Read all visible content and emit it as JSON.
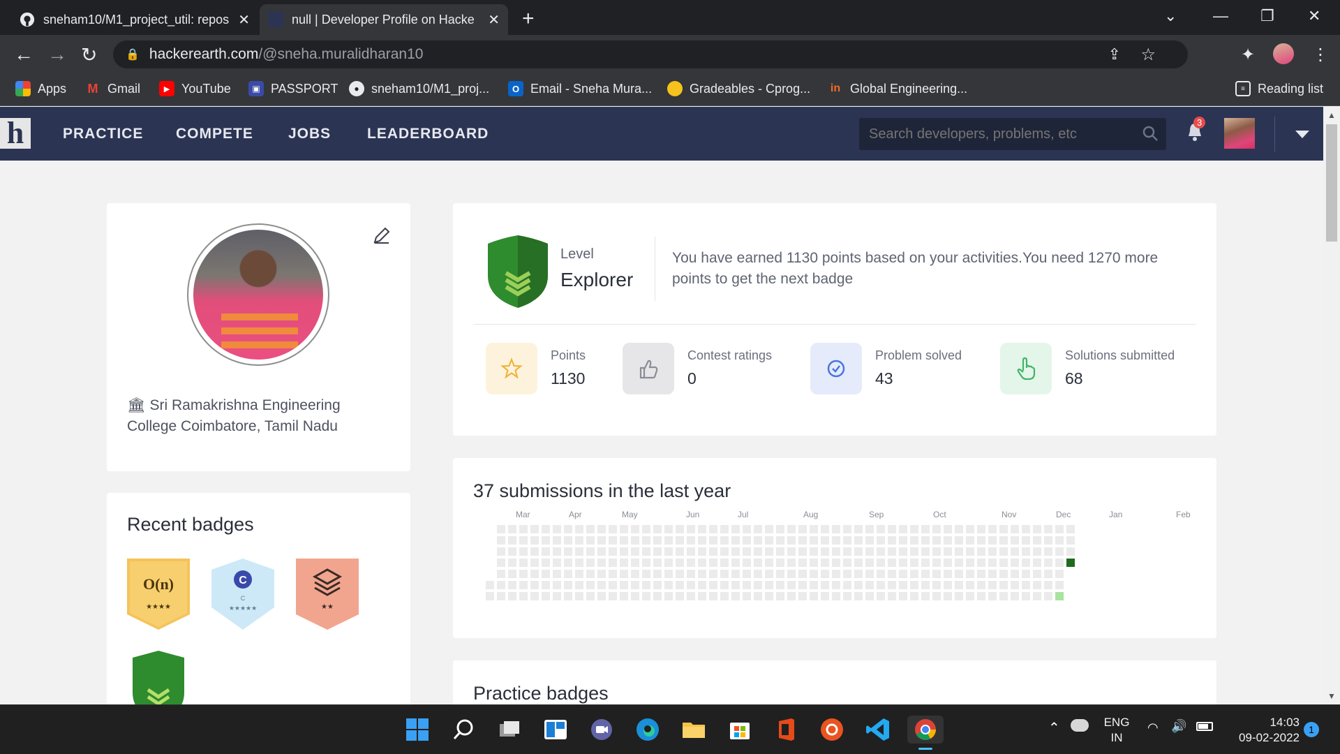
{
  "browser": {
    "tabs": [
      {
        "title": "sneham10/M1_project_util: repos",
        "icon": "github-icon"
      },
      {
        "title": "null | Developer Profile on Hacke",
        "icon": "hackerearth-icon"
      }
    ],
    "url_host": "hackerearth.com",
    "url_path": "/@sneha.muralidharan10",
    "bookmarks": [
      {
        "label": "Apps",
        "icon": "apps-grid-icon",
        "color": "#ea4335"
      },
      {
        "label": "Gmail",
        "icon": "gmail-icon",
        "color": "#ea4335"
      },
      {
        "label": "YouTube",
        "icon": "youtube-icon",
        "color": "#ff0000"
      },
      {
        "label": "PASSPORT",
        "icon": "passport-icon",
        "color": "#3a4aa6"
      },
      {
        "label": "sneham10/M1_proj...",
        "icon": "github-icon",
        "color": "#ffffff"
      },
      {
        "label": "Email - Sneha Mura...",
        "icon": "outlook-icon",
        "color": "#0a64c8"
      },
      {
        "label": "Gradeables - Cprog...",
        "icon": "duck-icon",
        "color": "#f6c21c"
      },
      {
        "label": "Global Engineering...",
        "icon": "in-logo-icon",
        "color": "#f26b22"
      }
    ],
    "reading_list": "Reading list"
  },
  "header": {
    "logo": "h",
    "nav": [
      "PRACTICE",
      "COMPETE",
      "JOBS",
      "LEADERBOARD"
    ],
    "search_placeholder": "Search developers, problems, etc",
    "notifications": "3"
  },
  "profile": {
    "college": "Sri Ramakrishna Engineering College Coimbatore, Tamil Nadu"
  },
  "recent_badges": {
    "title": "Recent badges",
    "items": [
      {
        "name": "O(n)",
        "stars": "★★★★",
        "color": "#f5c35b"
      },
      {
        "name": "C",
        "sub": "C",
        "stars": "★★★★★",
        "color": "#cde9f7"
      },
      {
        "name": "stack",
        "stars": "★★",
        "color": "#f2a58e"
      },
      {
        "name": "level",
        "color": "#2e8b2e"
      }
    ]
  },
  "level": {
    "label": "Level",
    "name": "Explorer",
    "message": "You have earned 1130 points based on your activities.You need 1270 more points to get the next badge"
  },
  "stats": [
    {
      "label": "Points",
      "value": "1130",
      "icon": "star-icon",
      "bg": "#fdf3dd",
      "color": "#f0b43c"
    },
    {
      "label": "Contest ratings",
      "value": "0",
      "icon": "thumbs-up-icon",
      "bg": "#e6e6e8",
      "color": "#8a8d96"
    },
    {
      "label": "Problem solved",
      "value": "43",
      "icon": "check-circle-icon",
      "bg": "#e5ebfb",
      "color": "#4a74e0"
    },
    {
      "label": "Solutions submitted",
      "value": "68",
      "icon": "pointer-hand-icon",
      "bg": "#e4f6e9",
      "color": "#41b36a"
    }
  ],
  "submissions": {
    "title": "37 submissions in the last year",
    "months": [
      "Mar",
      "Apr",
      "May",
      "Jun",
      "Jul",
      "Aug",
      "Sep",
      "Oct",
      "Nov",
      "Dec",
      "Jan",
      "Feb"
    ]
  },
  "practice_badges": {
    "title": "Practice badges"
  },
  "taskbar": {
    "lang": "ENG",
    "region": "IN",
    "time": "14:03",
    "date": "09-02-2022",
    "notif_count": "1"
  }
}
